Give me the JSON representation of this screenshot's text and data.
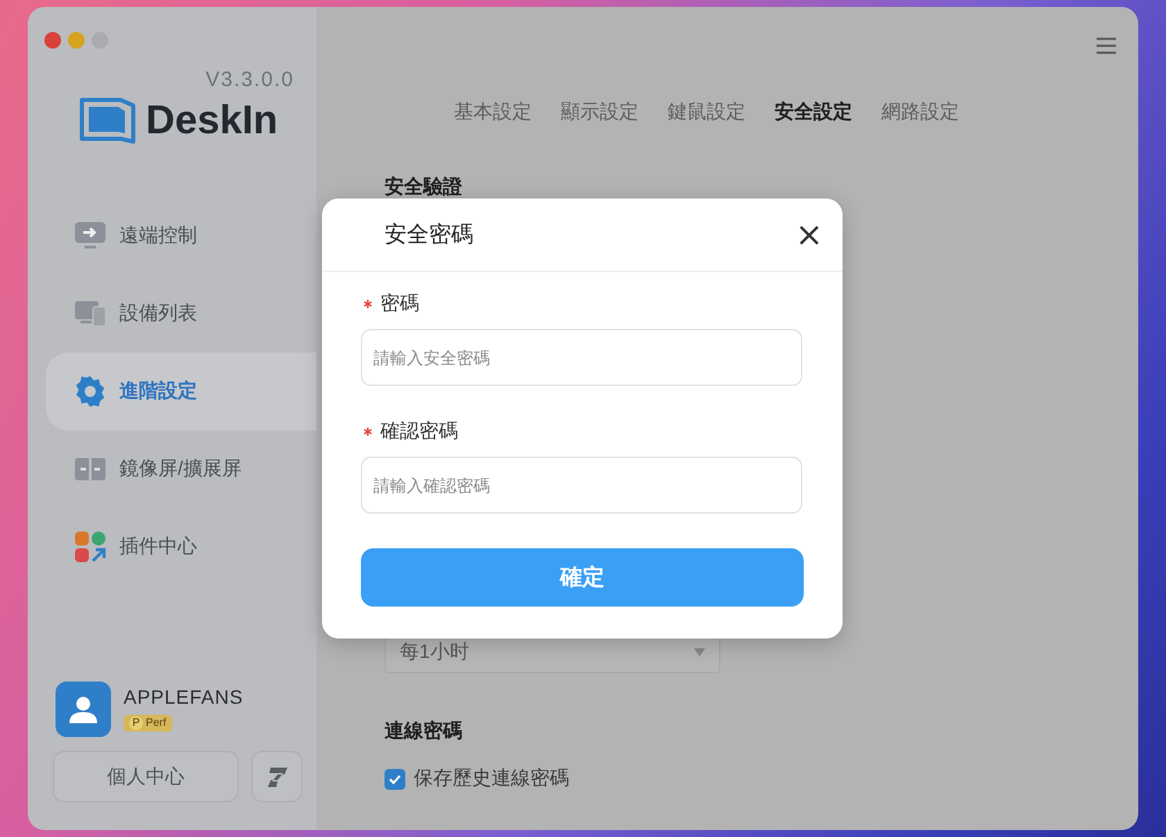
{
  "sidebar": {
    "version": "V3.3.0.0",
    "brand": "DeskIn",
    "items": [
      {
        "label": "遠端控制",
        "kind": "remote",
        "selected": false
      },
      {
        "label": "設備列表",
        "kind": "devices",
        "selected": false
      },
      {
        "label": "進階設定",
        "kind": "settings",
        "selected": true
      },
      {
        "label": "鏡像屏/擴展屏",
        "kind": "mirror",
        "selected": false
      },
      {
        "label": "插件中心",
        "kind": "plugins",
        "selected": false
      }
    ],
    "user": {
      "name": "APPLEFANS",
      "badge_letter": "P",
      "badge": "Perf"
    },
    "profile_button": "個人中心"
  },
  "main": {
    "tabs": [
      {
        "label": "基本設定",
        "selected": false
      },
      {
        "label": "顯示設定",
        "selected": false
      },
      {
        "label": "鍵鼠設定",
        "selected": false
      },
      {
        "label": "安全設定",
        "selected": true
      },
      {
        "label": "網路設定",
        "selected": false
      }
    ],
    "section_title": "安全驗證",
    "dropdown": {
      "value": "每1小时"
    },
    "password_section": {
      "title": "連線密碼",
      "checkbox": {
        "label": "保存歷史連線密碼",
        "checked": true
      }
    }
  },
  "dialog": {
    "title": "安全密碼",
    "close": "×",
    "fields": [
      {
        "label": "密碼",
        "required": true,
        "placeholder": "請輸入安全密碼"
      },
      {
        "label": "確認密碼",
        "required": true,
        "placeholder": "請輸入確認密碼"
      }
    ],
    "confirm": "確定"
  }
}
